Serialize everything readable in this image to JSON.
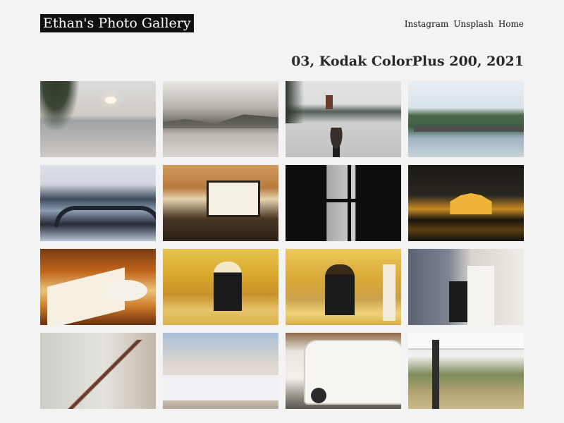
{
  "site": {
    "title": "Ethan's Photo Gallery"
  },
  "nav": {
    "items": [
      "Instagram",
      "Unsplash",
      "Home"
    ]
  },
  "album": {
    "title": "03, Kodak ColorPlus 200, 2021"
  },
  "photos": [
    {
      "name": "photo-lake-willow-sunset",
      "bg": "linear-gradient(#dcdcdc 0%, #cfcac3 45%, #9fa2a5 52%, #cfcac6 100%)"
    },
    {
      "name": "photo-lake-clouds-hills",
      "bg": "linear-gradient(#e9e7e4 0%, #b8b3ac 35%, #6d6d64 55%, #bdb8b1 70%, #d8d4cf 100%)"
    },
    {
      "name": "photo-pagoda-lake-person",
      "bg": "linear-gradient(#e2e2e4 0%, #dcdcde 30%, #55605a 40%, #cfcfcf 55%, #c2c2c2 100%)"
    },
    {
      "name": "photo-lake-pier-trees",
      "bg": "linear-gradient(#e7eef3 0%, #d8e3ea 35%, #4e6a4e 45%, #3c5d43 60%, #9fb3c1 75%, #c8d3da 100%)"
    },
    {
      "name": "photo-stone-bridge-lake",
      "bg": "linear-gradient(#dde0e8 0%, #d2d6e0 25%, #3d4b5c 45%, #8f9db3 60%, #262c38 78%, #b7c2d4 100%)"
    },
    {
      "name": "photo-cafe-interior",
      "bg": "linear-gradient(#d09a5a 0%, #b87a3e 30%, #e6d4b0 45%, #4a3826 70%, #2a2017 100%)"
    },
    {
      "name": "photo-window-silhouette",
      "bg": "linear-gradient(90deg, #0d0d0d 0%, #0d0d0d 35%, #a7a7a7 36%, #cfcfcf 60%, #0d0d0d 61%, #0d0d0d 100%)"
    },
    {
      "name": "photo-night-pavilion",
      "bg": "linear-gradient(#1b1915 0%, #2a2720 40%, #c98b23 58%, #1a1611 72%, #5a3e12 85%, #14120f 100%)"
    },
    {
      "name": "photo-sushi-plate",
      "bg": "linear-gradient(#7a3b12 0%, #c2671c 30%, #e8c37a 55%, #cf7d2a 75%, #6a2f0c 100%)"
    },
    {
      "name": "photo-chef-kitchen",
      "bg": "linear-gradient(#e8c34c 0%, #d8a82a 35%, #c7912a 60%, #e6c36a 80%, #d9b24a 100%)"
    },
    {
      "name": "photo-chef-cooking",
      "bg": "linear-gradient(#ecc85a 0%, #d9a836 40%, #caa04a 65%, #efd47a 85%, #d7ad45 100%)"
    },
    {
      "name": "photo-shirts-hanging",
      "bg": "linear-gradient(90deg, #5a6372 0%, #7d8594 35%, #d8d4cc 55%, #eeece6 100%)"
    },
    {
      "name": "photo-stairs-frames",
      "bg": "linear-gradient(90deg, #cfcdc8 0%, #e4e2dd 55%, #c2b8aa 100%)"
    },
    {
      "name": "photo-market-stall",
      "bg": "linear-gradient(#a8c0d8 0%, #dcd6cf 40%, #e9e2d8 70%, #b2a69a 100%)"
    },
    {
      "name": "photo-white-van",
      "bg": "linear-gradient(#8c6a4a 0%, #e9e6dd 25%, #f2efe8 60%, #8e8a80 85%, #5a5650 100%)"
    },
    {
      "name": "photo-outdoor-tent-market",
      "bg": "linear-gradient(#cfd7dc 0%, #f3f3f1 30%, #7d8a5a 55%, #b7a774 80%, #c8b987 100%)"
    }
  ]
}
